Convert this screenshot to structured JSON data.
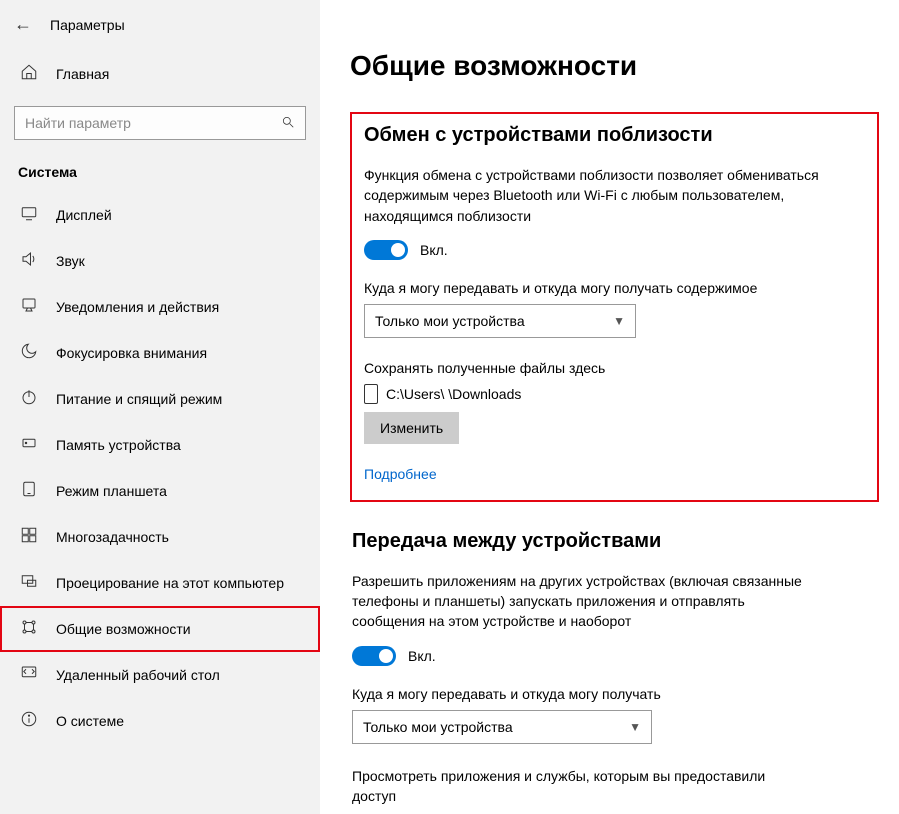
{
  "header": {
    "title": "Параметры"
  },
  "home_label": "Главная",
  "search": {
    "placeholder": "Найти параметр"
  },
  "category": "Система",
  "nav": {
    "display": "Дисплей",
    "sound": "Звук",
    "notifications": "Уведомления и действия",
    "focus": "Фокусировка внимания",
    "power": "Питание и спящий режим",
    "storage": "Память устройства",
    "tablet": "Режим планшета",
    "multitask": "Многозадачность",
    "project": "Проецирование на этот компьютер",
    "shared": "Общие возможности",
    "remote": "Удаленный рабочий стол",
    "about": "О системе"
  },
  "page_title": "Общие возможности",
  "section1": {
    "title": "Обмен с устройствами поблизости",
    "desc": "Функция обмена с устройствами поблизости позволяет обмениваться содержимым через Bluetooth или Wi-Fi с любым пользователем, находящимся поблизости",
    "toggle_state": "Вкл.",
    "where_label": "Куда я могу передавать и откуда могу получать содержимое",
    "select_value": "Только мои устройства",
    "save_label": "Сохранять полученные файлы здесь",
    "save_path": "C:\\Users\\        \\Downloads",
    "change_btn": "Изменить",
    "more_link": "Подробнее"
  },
  "section2": {
    "title": "Передача между устройствами",
    "desc": "Разрешить приложениям на других устройствах (включая связанные телефоны и планшеты) запускать приложения и отправлять сообщения на этом устройстве и наоборот",
    "toggle_state": "Вкл.",
    "where_label": "Куда я могу передавать и откуда могу получать",
    "select_value": "Только мои устройства",
    "footer": "Просмотреть приложения и службы, которым вы предоставили доступ"
  }
}
